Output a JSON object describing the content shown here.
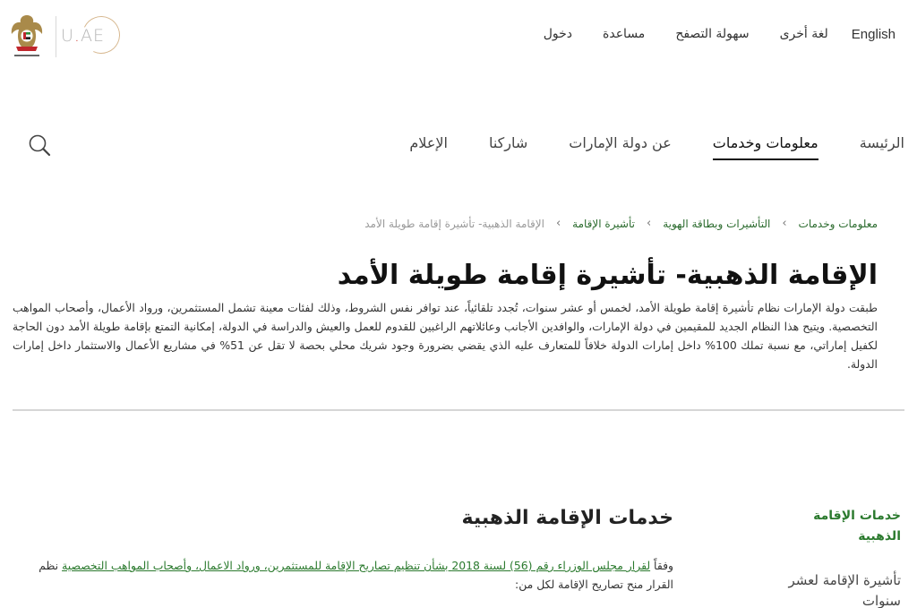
{
  "header": {
    "logo": {
      "emblem_alt": "UAE emblem",
      "brand_text": "U.AE"
    },
    "utility_nav": {
      "english": "English",
      "other_language": "لغة أخرى",
      "accessibility": "سهولة التصفح",
      "help": "مساعدة",
      "login": "دخول"
    },
    "main_nav": [
      {
        "label": "الرئيسة",
        "active": false
      },
      {
        "label": "معلومات وخدمات",
        "active": true
      },
      {
        "label": "عن دولة الإمارات",
        "active": false
      },
      {
        "label": "شاركنا",
        "active": false
      },
      {
        "label": "الإعلام",
        "active": false
      }
    ],
    "search_icon": "search-icon"
  },
  "breadcrumb": [
    "معلومات وخدمات",
    "التأشيرات وبطاقة الهوية",
    "تأشيرة الإقامة",
    "الإقامة الذهبية- تأشيرة إقامة طويلة الأمد"
  ],
  "breadcrumb_separator": "›",
  "page": {
    "title": "الإقامة الذهبية- تأشيرة إقامة طويلة الأمد",
    "intro": "طبقت دولة الإمارات نظام تأشيرة إقامة طويلة الأمد، لخمس أو عشر سنوات، تُجدد تلقائياً، عند توافر نفس الشروط، وذلك لفئات معينة تشمل المستثمرين، ورواد الأعمال، وأصحاب المواهب التخصصية. ويتيح هذا النظام الجديد للمقيمين في دولة الإمارات، والوافدين الأجانب وعائلاتهم الراغبين للقدوم للعمل والعيش والدراسة في الدولة، إمكانية التمتع بإقامة طويلة الأمد دون الحاجة لكفيل إماراتي، مع نسبة تملك 100% داخل إمارات الدولة خلافاً للمتعارف عليه الذي يقضي بضرورة وجود شريك محلي بحصة لا تقل عن 51% في مشاريع الأعمال والاستثمار داخل إمارات الدولة."
  },
  "side_menu": {
    "title": "خدمات الإقامة الذهبية",
    "items": [
      "تأشيرة الإقامة لعشر سنوات"
    ]
  },
  "section": {
    "title": "خدمات الإقامة الذهبية",
    "prefix": "وفقاً ",
    "link_text": "لقرار مجلس الوزراء رقم (56) لسنة 2018 بشأن تنظيم تصاريح الإقامة للمستثمرين، ورواد الاعمال، وأصحاب المواهب التخصصية",
    "suffix": " نظم القرار منح تصاريح الإقامة لكل من:"
  },
  "colors": {
    "accent_green": "#2b7a2e",
    "breadcrumb_current": "#999999",
    "logo_ring": "#d7b890"
  }
}
